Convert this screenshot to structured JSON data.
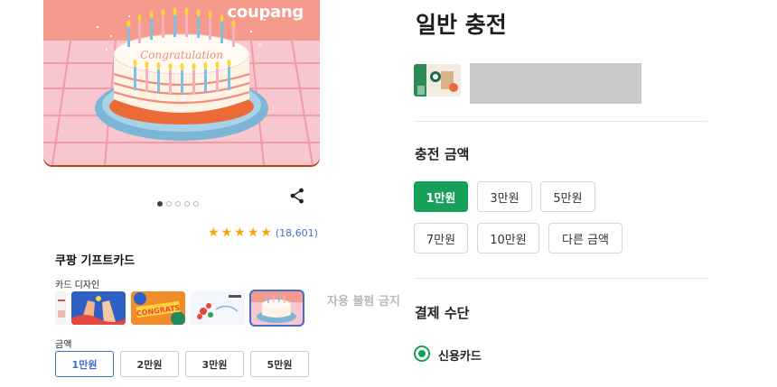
{
  "hero": {
    "brand": "coupang",
    "cake_text": "Congratulation"
  },
  "carousel": {
    "count": 5,
    "active_index": 0
  },
  "rating": {
    "stars": 5,
    "count_text": "(18,601)"
  },
  "product": {
    "title": "쿠팡 기프트카드"
  },
  "design": {
    "label": "카드 디자인",
    "thumbnails": [
      "coupang",
      "high-five",
      "congrats",
      "flowers",
      "birthday-cake"
    ],
    "selected_thumbnail": "birthday-cake",
    "congrats_text": "CONGRATS"
  },
  "amount": {
    "label": "금액",
    "options": [
      "1만원",
      "2만원",
      "3만원",
      "5만원"
    ],
    "selected": "1만원"
  },
  "watermark": "자용 불펌 금지",
  "charge": {
    "title": "일반 충전",
    "amount_title": "충전 금액",
    "amounts_row1": [
      "1만원",
      "3만원",
      "5만원"
    ],
    "amounts_row2": [
      "7만원",
      "10만원",
      "다른 금액"
    ],
    "selected": "1만원"
  },
  "payment": {
    "title": "결제 수단",
    "option": "신용카드"
  },
  "colors": {
    "accent_green": "#16a05a",
    "accent_blue": "#3e6ec8",
    "star": "#f4a60d",
    "hero_bg": "#f59a8c"
  }
}
